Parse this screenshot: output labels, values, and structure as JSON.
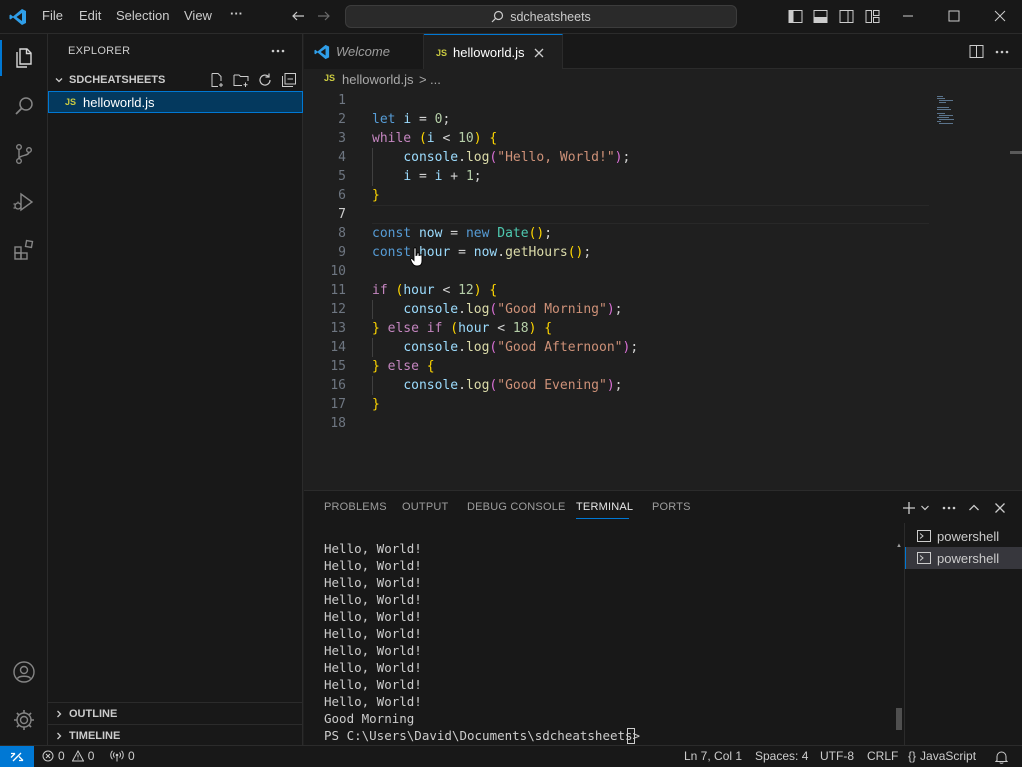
{
  "titlebar": {
    "menu": [
      "File",
      "Edit",
      "Selection",
      "View",
      "···"
    ],
    "search_text": "sdcheatsheets"
  },
  "sidebar": {
    "title": "EXPLORER",
    "folder": "SDCHEATSHEETS",
    "files": [
      {
        "name": "helloworld.js",
        "icon": "JS",
        "selected": true
      }
    ],
    "outline": "OUTLINE",
    "timeline": "TIMELINE"
  },
  "tabs": [
    {
      "label": "Welcome",
      "active": false
    },
    {
      "label": "helloworld.js",
      "icon": "JS",
      "active": true
    }
  ],
  "breadcrumb": {
    "icon": "JS",
    "file": "helloworld.js",
    "sep": ">",
    "more": "..."
  },
  "editor": {
    "line_numbers": [
      "1",
      "2",
      "3",
      "4",
      "5",
      "6",
      "7",
      "8",
      "9",
      "10",
      "11",
      "12",
      "13",
      "14",
      "15",
      "16",
      "17",
      "18"
    ],
    "current_line": 7
  },
  "panel": {
    "tabs": [
      "PROBLEMS",
      "OUTPUT",
      "DEBUG CONSOLE",
      "TERMINAL",
      "PORTS"
    ],
    "active_tab": "TERMINAL",
    "terminal_lines": [
      "Hello, World!",
      "Hello, World!",
      "Hello, World!",
      "Hello, World!",
      "Hello, World!",
      "Hello, World!",
      "Hello, World!",
      "Hello, World!",
      "Hello, World!",
      "Hello, World!",
      "Good Morning",
      "PS C:\\Users\\David\\Documents\\sdcheatsheets> "
    ],
    "terminals": [
      "powershell",
      "powershell"
    ]
  },
  "statusbar": {
    "errors": "0",
    "warnings": "0",
    "ports": "0",
    "position": "Ln 7, Col 1",
    "spaces": "Spaces: 4",
    "encoding": "UTF-8",
    "eol": "CRLF",
    "language_icon": "{}",
    "language": "JavaScript"
  },
  "colors": {
    "accent": "#0078d4",
    "js_icon": "#cbcb41",
    "selected_bg": "#04395e"
  }
}
